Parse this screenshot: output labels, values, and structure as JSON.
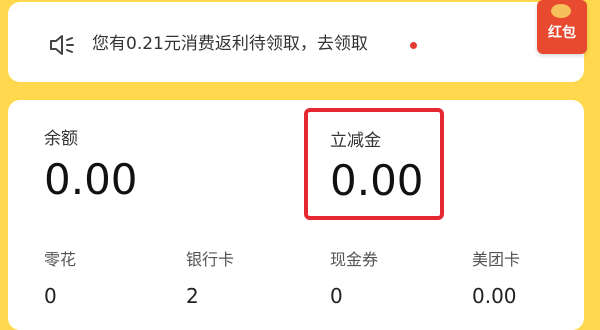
{
  "notice": {
    "text": "您有0.21元消费返利待领取，去领取",
    "icon": "speaker-icon"
  },
  "red_packet": {
    "label": "红包"
  },
  "balance": {
    "label": "余额",
    "value": "0.00"
  },
  "instant_discount": {
    "label": "立减金",
    "value": "0.00"
  },
  "assets": [
    {
      "label": "零花",
      "value": "0"
    },
    {
      "label": "银行卡",
      "value": "2"
    },
    {
      "label": "现金券",
      "value": "0"
    },
    {
      "label": "美团卡",
      "value": "0.00"
    }
  ],
  "colors": {
    "background": "#FFD84D",
    "highlight": "#E5282F",
    "notice_dot": "#E53935",
    "red_packet": "#E84A2F"
  }
}
